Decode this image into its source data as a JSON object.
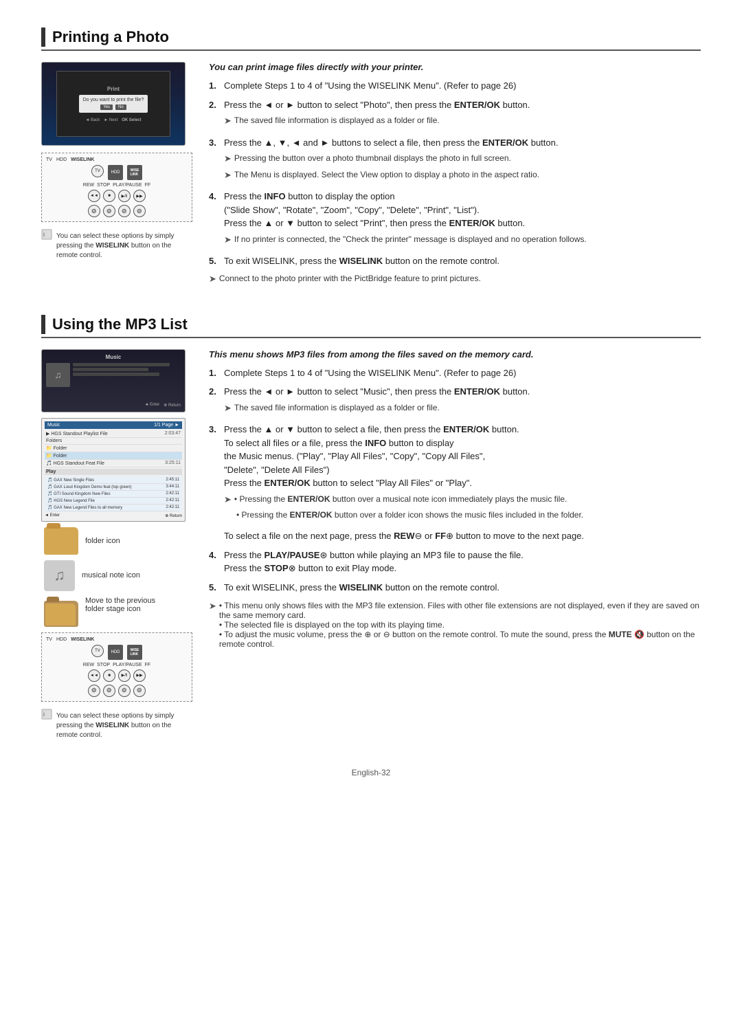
{
  "printing_section": {
    "title": "Printing a Photo",
    "heading": "You can print image files directly with your printer.",
    "steps": [
      {
        "num": "1.",
        "text": "Complete Steps 1 to 4 of \"Using the WISELINK Menu\". (Refer to page 26)"
      },
      {
        "num": "2.",
        "text_parts": [
          "Press the ◄ or ► button to select \"Photo\", then press the ",
          "ENTER/OK",
          " button."
        ],
        "note": "The saved file information is displayed as a folder or file."
      },
      {
        "num": "3.",
        "text_parts": [
          "Press the ▲, ▼, ◄ and ► buttons to select a file, then press the ",
          "ENTER/OK",
          " button."
        ],
        "notes": [
          "Pressing the button over a photo thumbnail displays the photo in full screen.",
          "The Menu is displayed. Select the View option to display a photo in the aspect ratio."
        ]
      },
      {
        "num": "4.",
        "text_parts": [
          "Press the ",
          "INFO",
          " button to display the option"
        ],
        "extra": "(\"Slide Show\", \"Rotate\", \"Zoom\", \"Copy\", \"Delete\", \"Print\", \"List\").",
        "text_parts2": [
          "Press the ▲ or ▼ button to select \"Print\", then press the ",
          "ENTER/OK",
          " button."
        ],
        "note": "If no printer is connected, the \"Check the printer\" message is displayed and no operation follows."
      },
      {
        "num": "5.",
        "text_parts": [
          "To exit WISELINK, press the ",
          "WISELINK",
          " button on the remote control."
        ]
      }
    ],
    "bottom_note": "Connect to the photo printer with the PictBridge feature to print pictures.",
    "remote_note": "You can select these options by simply pressing the WISELINK button on the remote control."
  },
  "mp3_section": {
    "title": "Using the MP3 List",
    "heading": "This menu shows MP3 files from among the files saved on the memory card.",
    "steps": [
      {
        "num": "1.",
        "text": "Complete Steps 1 to 4 of \"Using the WISELINK Menu\". (Refer to page 26)"
      },
      {
        "num": "2.",
        "text_parts": [
          "Press the ◄ or ► button to select \"Music\", then press the ",
          "ENTER/OK",
          " button."
        ],
        "note": "The saved file information is displayed as a folder or file."
      },
      {
        "num": "3.",
        "text_parts": [
          "Press the ▲ or ▼ button to select a file, then press the ",
          "ENTER/OK",
          " button."
        ],
        "extra": "To select all files or a file, press the ",
        "extra_bold": "INFO",
        "extra2": " button to display the Music menus. (\"Play\", \"Play All Files\", \"Copy\", \"Copy All Files\", \"Delete\", \"Delete All Files\")",
        "extra3_parts": [
          "Press the ",
          "ENTER/OK",
          " button to select \"Play All Files\" or \"Play\"."
        ],
        "notes": [
          "Pressing the ENTER/OK button over a musical note icon immediately plays the music file.",
          "Pressing the ENTER/OK button over a folder icon shows the music files included in the folder."
        ]
      },
      {
        "num": "",
        "text_parts": [
          "To select a file on the next page, press the ",
          "REW",
          "⊖",
          " or ",
          "FF",
          "⊕",
          " button to move to the next page."
        ]
      },
      {
        "num": "4.",
        "text_parts": [
          "Press the ",
          "PLAY/PAUSE",
          "⊛",
          " button while playing an MP3 file to pause the file. Press the ",
          "STOP",
          "⊗",
          " button to exit Play mode."
        ]
      },
      {
        "num": "5.",
        "text_parts": [
          "To exit WISELINK, press the ",
          "WISELINK",
          " button on the remote control."
        ]
      }
    ],
    "bottom_notes": [
      "This menu only shows files with the MP3 file extension. Files with other file extensions are not displayed, even if they are saved on the same memory card.",
      "The selected file is displayed on the top with its playing time.",
      "To adjust the music volume, press the ⊕ or ⊖ button on the remote control. To mute the sound, press the MUTE 🔇 button on the remote control."
    ],
    "folder_icon_label": "folder icon",
    "note_icon_label": "musical note icon",
    "prev_folder_label": "Move to the previous folder stage icon",
    "remote_note": "You can select these options by simply pressing the WISELINK button on the remote control."
  },
  "remote": {
    "tv": "TV",
    "hdd": "HDD",
    "wiselink": "WISELINK",
    "rew": "REW",
    "stop": "STOP",
    "play_pause": "PLAY/PAUSE",
    "ff": "FF"
  },
  "footer": {
    "text": "English-32"
  }
}
